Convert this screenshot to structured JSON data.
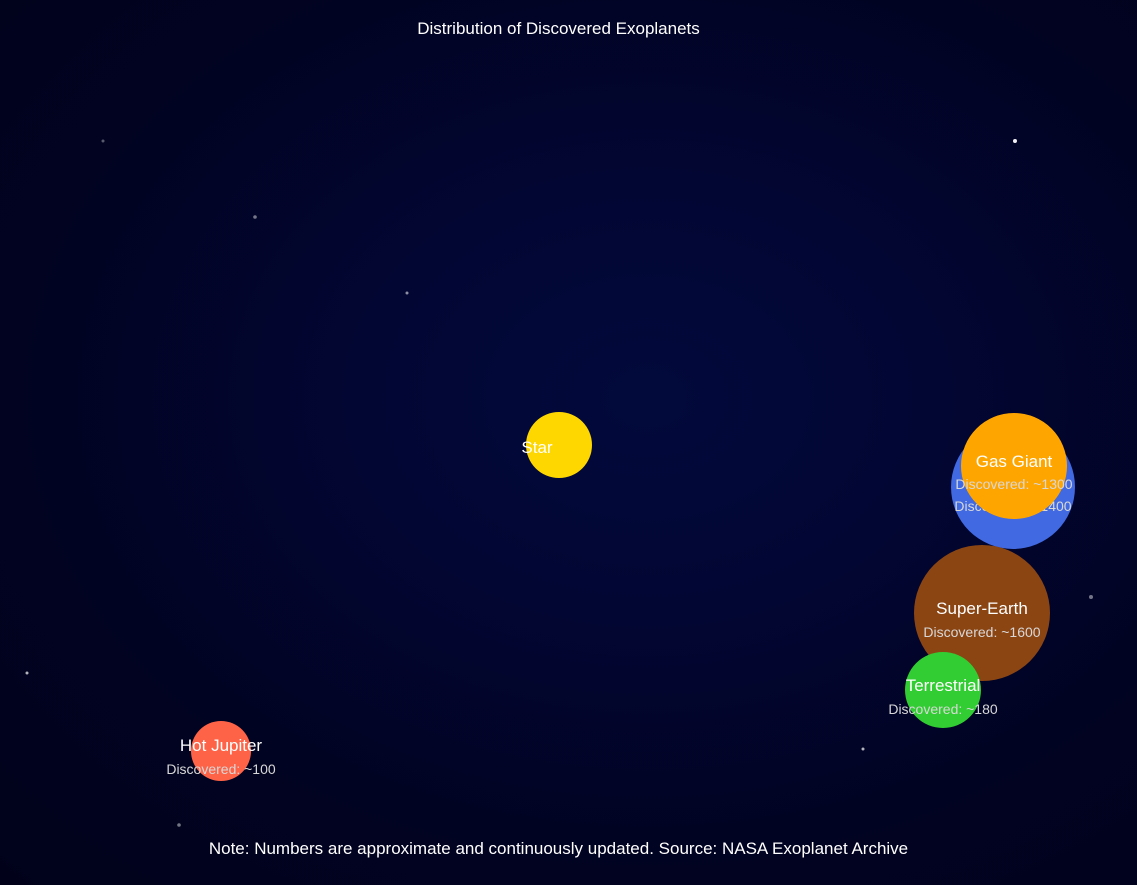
{
  "title": "Distribution of Discovered Exoplanets",
  "note": "Note: Numbers are approximate and continuously updated. Source: NASA Exoplanet Archive",
  "star": {
    "label": "Star",
    "color": "#FFD700"
  },
  "planets": [
    {
      "id": "neptune-like",
      "label": "",
      "count_text": "Discovered: ~1400",
      "color": "#4169E1"
    },
    {
      "id": "gas-giant",
      "label": "Gas Giant",
      "count_text": "Discovered: ~1300",
      "color": "#FFA500"
    },
    {
      "id": "super-earth",
      "label": "Super-Earth",
      "count_text": "Discovered: ~1600",
      "color": "#8B4513"
    },
    {
      "id": "terrestrial",
      "label": "Terrestrial",
      "count_text": "Discovered: ~180",
      "color": "#32CD32"
    },
    {
      "id": "hot-jupiter",
      "label": "Hot Jupiter",
      "count_text": "Discovered: ~100",
      "color": "#FF6347"
    }
  ]
}
